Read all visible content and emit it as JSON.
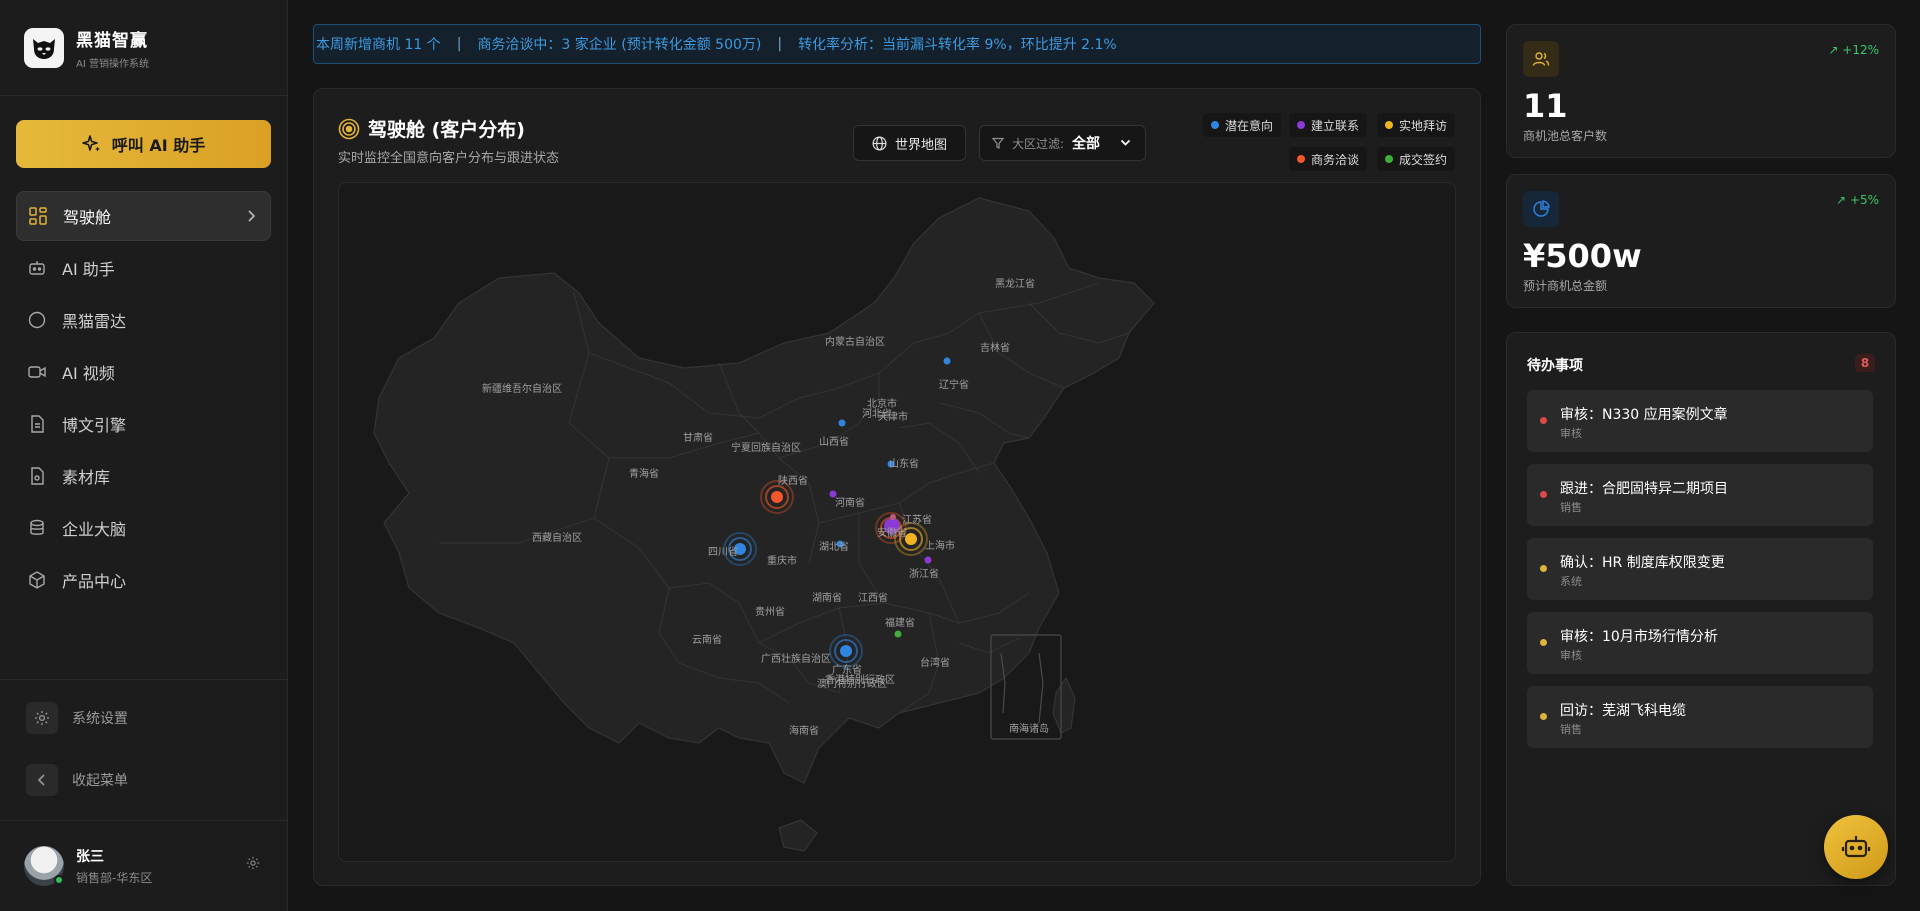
{
  "brand": {
    "name": "黑猫智赢",
    "subtitle": "AI 营销操作系统"
  },
  "ai_button": {
    "label": "呼叫 AI 助手"
  },
  "nav": {
    "items": [
      {
        "label": "驾驶舱",
        "icon": "dashboard-icon",
        "active": true
      },
      {
        "label": "AI 助手",
        "icon": "robot-icon"
      },
      {
        "label": "黑猫雷达",
        "icon": "radar-icon"
      },
      {
        "label": "AI 视频",
        "icon": "video-icon"
      },
      {
        "label": "博文引擎",
        "icon": "document-icon"
      },
      {
        "label": "素材库",
        "icon": "file-icon"
      },
      {
        "label": "企业大脑",
        "icon": "database-icon"
      },
      {
        "label": "产品中心",
        "icon": "box-icon"
      }
    ]
  },
  "footer": {
    "settings": "系统设置",
    "collapse": "收起菜单"
  },
  "user": {
    "name": "张三",
    "dept": "销售部-华东区"
  },
  "ticker": {
    "items": [
      "本周新增商机 11 个",
      "商务洽谈中：3 家企业 (预计转化金额 500万)",
      "转化率分析：当前漏斗转化率 9%，环比提升 2.1%"
    ],
    "separator": "|"
  },
  "panel": {
    "title": "驾驶舱 (客户分布)",
    "subtitle": "实时监控全国意向客户分布与跟进状态",
    "world_map_button": "世界地图",
    "filter_label": "大区过滤:",
    "filter_value": "全部"
  },
  "legend": [
    {
      "label": "潜在意向",
      "color": "#2f86e0"
    },
    {
      "label": "建立联系",
      "color": "#8b3ad6"
    },
    {
      "label": "实地拜访",
      "color": "#f0b420"
    },
    {
      "label": "商务洽谈",
      "color": "#f0582a"
    },
    {
      "label": "成交签约",
      "color": "#3fae3a"
    }
  ],
  "map": {
    "labels": [
      "黑龙江省",
      "吉林省",
      "辽宁省",
      "内蒙古自治区",
      "北京市",
      "天津市",
      "河北省",
      "新疆维吾尔自治区",
      "甘肃省",
      "宁夏回族自治区",
      "山西省",
      "山东省",
      "青海省",
      "陕西省",
      "河南省",
      "江苏省",
      "安徽省",
      "上海市",
      "西藏自治区",
      "四川省",
      "重庆市",
      "湖北省",
      "浙江省",
      "湖南省",
      "江西省",
      "贵州省",
      "福建省",
      "云南省",
      "广西壮族自治区",
      "广东省",
      "台湾省",
      "香港特别行政区",
      "澳门特别行政区",
      "海南省",
      "南海诸岛"
    ]
  },
  "stats": [
    {
      "value": "11",
      "caption": "商机池总客户数",
      "trend": "+12%",
      "icon": "users-icon",
      "accent": "#e2b23a"
    },
    {
      "value": "¥500w",
      "caption": "预计商机总金额",
      "trend": "+5%",
      "icon": "pie-chart-icon",
      "accent": "#2f86e0"
    }
  ],
  "todo": {
    "title": "待办事项",
    "count": "8",
    "items": [
      {
        "title": "审核：N330 应用案例文章",
        "category": "审核",
        "color": "#e04848"
      },
      {
        "title": "跟进：合肥固特异二期项目",
        "category": "销售",
        "color": "#e04848"
      },
      {
        "title": "确认：HR 制度库权限变更",
        "category": "系统",
        "color": "#e0b43a"
      },
      {
        "title": "审核：10月市场行情分析",
        "category": "审核",
        "color": "#e0b43a"
      },
      {
        "title": "回访：芜湖飞科电缆",
        "category": "销售",
        "color": "#e0b43a"
      }
    ]
  }
}
